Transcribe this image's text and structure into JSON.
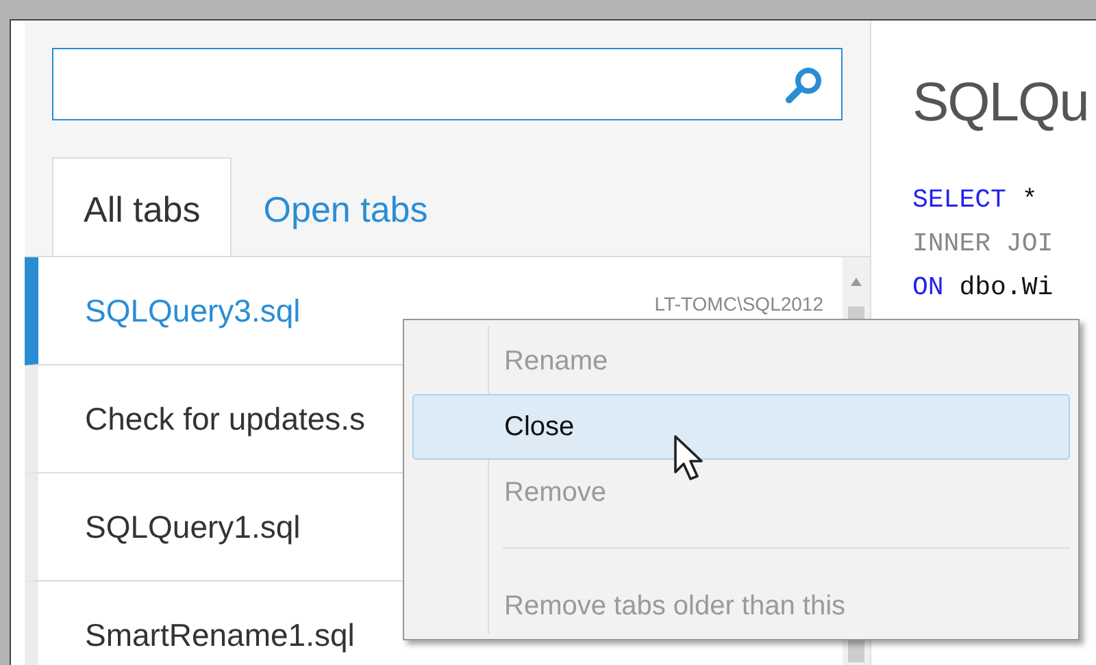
{
  "tabs": [
    {
      "label": "All tabs",
      "selected": true
    },
    {
      "label": "Open tabs",
      "selected": false
    }
  ],
  "rows": [
    {
      "name": "SQLQuery3.sql",
      "server": "LT-TOMC\\SQL2012",
      "selected": true
    },
    {
      "name": "Check for updates.s",
      "selected": false
    },
    {
      "name": "SQLQuery1.sql",
      "selected": false
    },
    {
      "name": "SmartRename1.sql",
      "selected": false
    }
  ],
  "editor": {
    "title": "SQLQu",
    "code_lines": [
      [
        {
          "kind": "keyword",
          "text": "SELECT"
        },
        {
          "kind": "plain",
          "text": " *"
        }
      ],
      [
        {
          "kind": "muted",
          "text": "INNER JOI"
        }
      ],
      [
        {
          "kind": "keyword",
          "text": "ON"
        },
        {
          "kind": "plain",
          "text": " dbo.Wi"
        }
      ]
    ]
  },
  "context_menu": {
    "items": [
      {
        "kind": "item",
        "label": "Rename",
        "disabled": true,
        "highlighted": false
      },
      {
        "kind": "item",
        "label": "Close",
        "disabled": false,
        "highlighted": true
      },
      {
        "kind": "item",
        "label": "Remove",
        "disabled": true,
        "highlighted": false
      },
      {
        "kind": "separator"
      },
      {
        "kind": "item",
        "label": "Remove tabs older than this",
        "disabled": true,
        "highlighted": false
      }
    ]
  }
}
